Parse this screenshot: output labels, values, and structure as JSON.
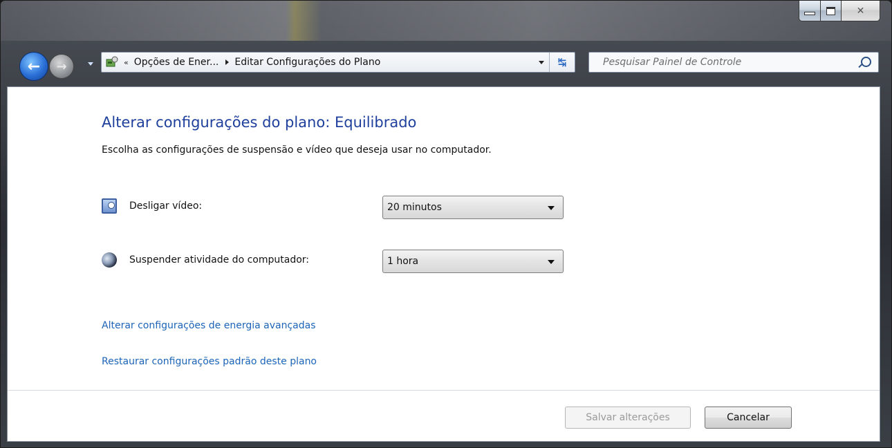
{
  "window": {
    "caption_buttons": {
      "minimize": "minimize-icon",
      "maximize": "maximize-icon",
      "close": "close-icon"
    }
  },
  "navigation": {
    "back_icon": "back-arrow-icon",
    "forward_icon": "forward-arrow-icon"
  },
  "address_bar": {
    "overflow_chevron": "«",
    "segments": [
      "Opções de Ener...",
      "Editar Configurações do Plano"
    ],
    "icon": "control-panel-icon",
    "refresh_icon": "refresh-icon"
  },
  "search": {
    "placeholder": "Pesquisar Painel de Controle",
    "icon": "search-icon"
  },
  "main": {
    "title": "Alterar configurações do plano: Equilibrado",
    "subtitle": "Escolha as configurações de suspensão e vídeo que deseja usar no computador.",
    "settings": [
      {
        "label": "Desligar vídeo:",
        "value": "20 minutos",
        "icon": "monitor-clock-icon"
      },
      {
        "label": "Suspender atividade do computador:",
        "value": "1 hora",
        "icon": "moon-sleep-icon"
      }
    ],
    "links": [
      "Alterar configurações de energia avançadas",
      "Restaurar configurações padrão deste plano"
    ]
  },
  "footer": {
    "save_label": "Salvar alterações",
    "cancel_label": "Cancelar"
  },
  "colors": {
    "title": "#1e3f9c",
    "link": "#1c64b8",
    "disabled_text": "#9a9a9a"
  }
}
